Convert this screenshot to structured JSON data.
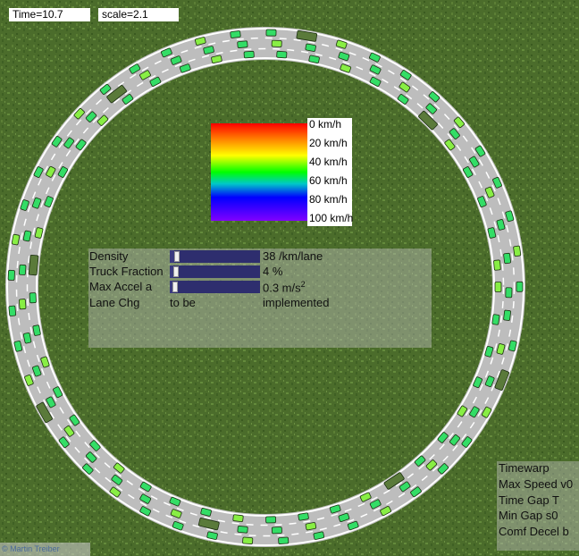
{
  "status": {
    "time_label": "Time=10.7",
    "scale_label": "scale=2.1"
  },
  "color_scale": {
    "labels": [
      "0 km/h",
      "20 km/h",
      "40 km/h",
      "60 km/h",
      "80 km/h",
      "100 km/h"
    ]
  },
  "controls": {
    "density": {
      "label": "Density",
      "value": "38 /km/lane",
      "level": 0.05
    },
    "truck_fraction": {
      "label": "Truck Fraction",
      "value": "4 %",
      "level": 0.04
    },
    "max_accel": {
      "label": "Max Accel a",
      "value": "0.3 m/s",
      "unit_sup": "2",
      "level": 0.03
    },
    "lane_change": {
      "label": "Lane Chg",
      "value_a": "to be",
      "value_b": "implemented"
    }
  },
  "right_panel": {
    "items": [
      "Timewarp",
      "Max Speed v0",
      "Time Gap T",
      "Min Gap s0",
      "Comf Decel b"
    ]
  },
  "copyright": "© Martin Treiber",
  "colors": {
    "grass": "#4a6b2a",
    "road": "#bdbdbd",
    "road_edge": "#ffffff",
    "lane_dash": "#ffffff",
    "car_fast": "#33dd66",
    "car_mid": "#88ee44",
    "truck": "#5a7a3a"
  },
  "vehicle_counts": {
    "cars": 126,
    "trucks": 8
  }
}
